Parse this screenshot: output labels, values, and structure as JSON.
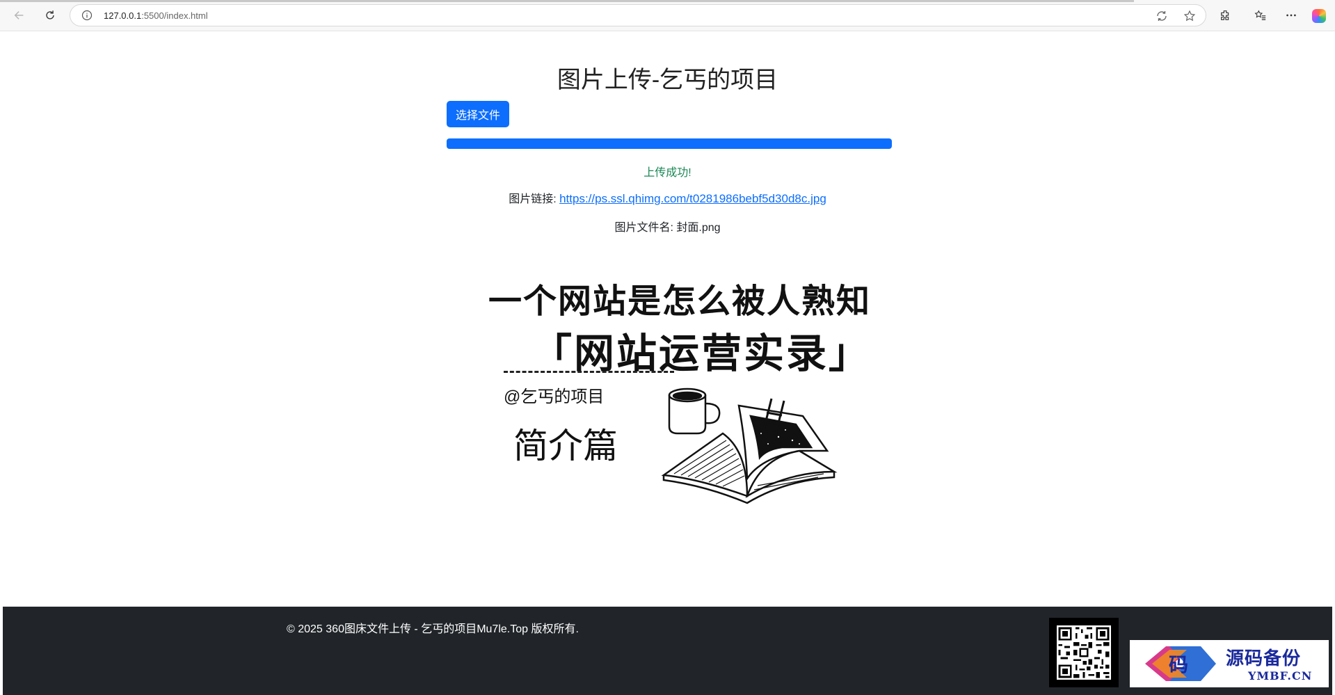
{
  "browser": {
    "url_host": "127.0.0.1",
    "url_path": ":5500/index.html"
  },
  "page": {
    "title": "图片上传-乞丐的项目",
    "choose_button": "选择文件",
    "progress_percent": 100,
    "status": "上传成功!",
    "link_label": "图片链接:",
    "link_url": "https://ps.ssl.qhimg.com/t0281986bebf5d30d8c.jpg",
    "filename_label": "图片文件名:",
    "filename": "封面.png"
  },
  "cover": {
    "line1": "一个网站是怎么被人熟知",
    "line2": "「网站运营实录」",
    "author": "@乞丐的项目",
    "intro": "简介篇"
  },
  "footer": {
    "copyright": "© 2025 360图床文件上传 - 乞丐的项目Mu7le.Top 版权所有."
  },
  "watermark": {
    "name": "源码备份",
    "domain": "YMBF.CN",
    "logo_char": "码"
  },
  "colors": {
    "primary": "#0d6efd",
    "success": "#198754",
    "footer_bg": "#212529"
  }
}
